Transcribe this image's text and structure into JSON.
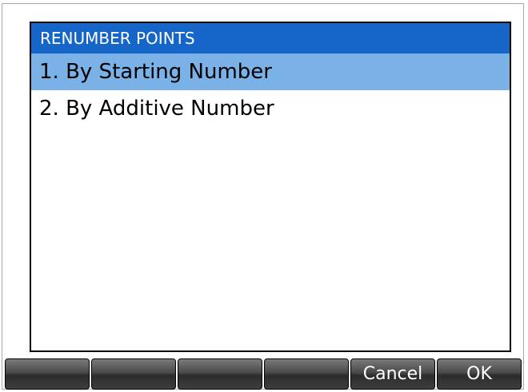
{
  "dialog": {
    "title": "RENUMBER POINTS",
    "items": [
      {
        "label": "1. By Starting Number",
        "selected": true
      },
      {
        "label": "2. By Additive Number",
        "selected": false
      }
    ]
  },
  "softkeys": [
    "",
    "",
    "",
    "",
    "Cancel",
    "OK"
  ],
  "colors": {
    "title_bar": "#1566c8",
    "selection": "#7ab2e8",
    "softkey_dark": "#2c2c2c"
  }
}
